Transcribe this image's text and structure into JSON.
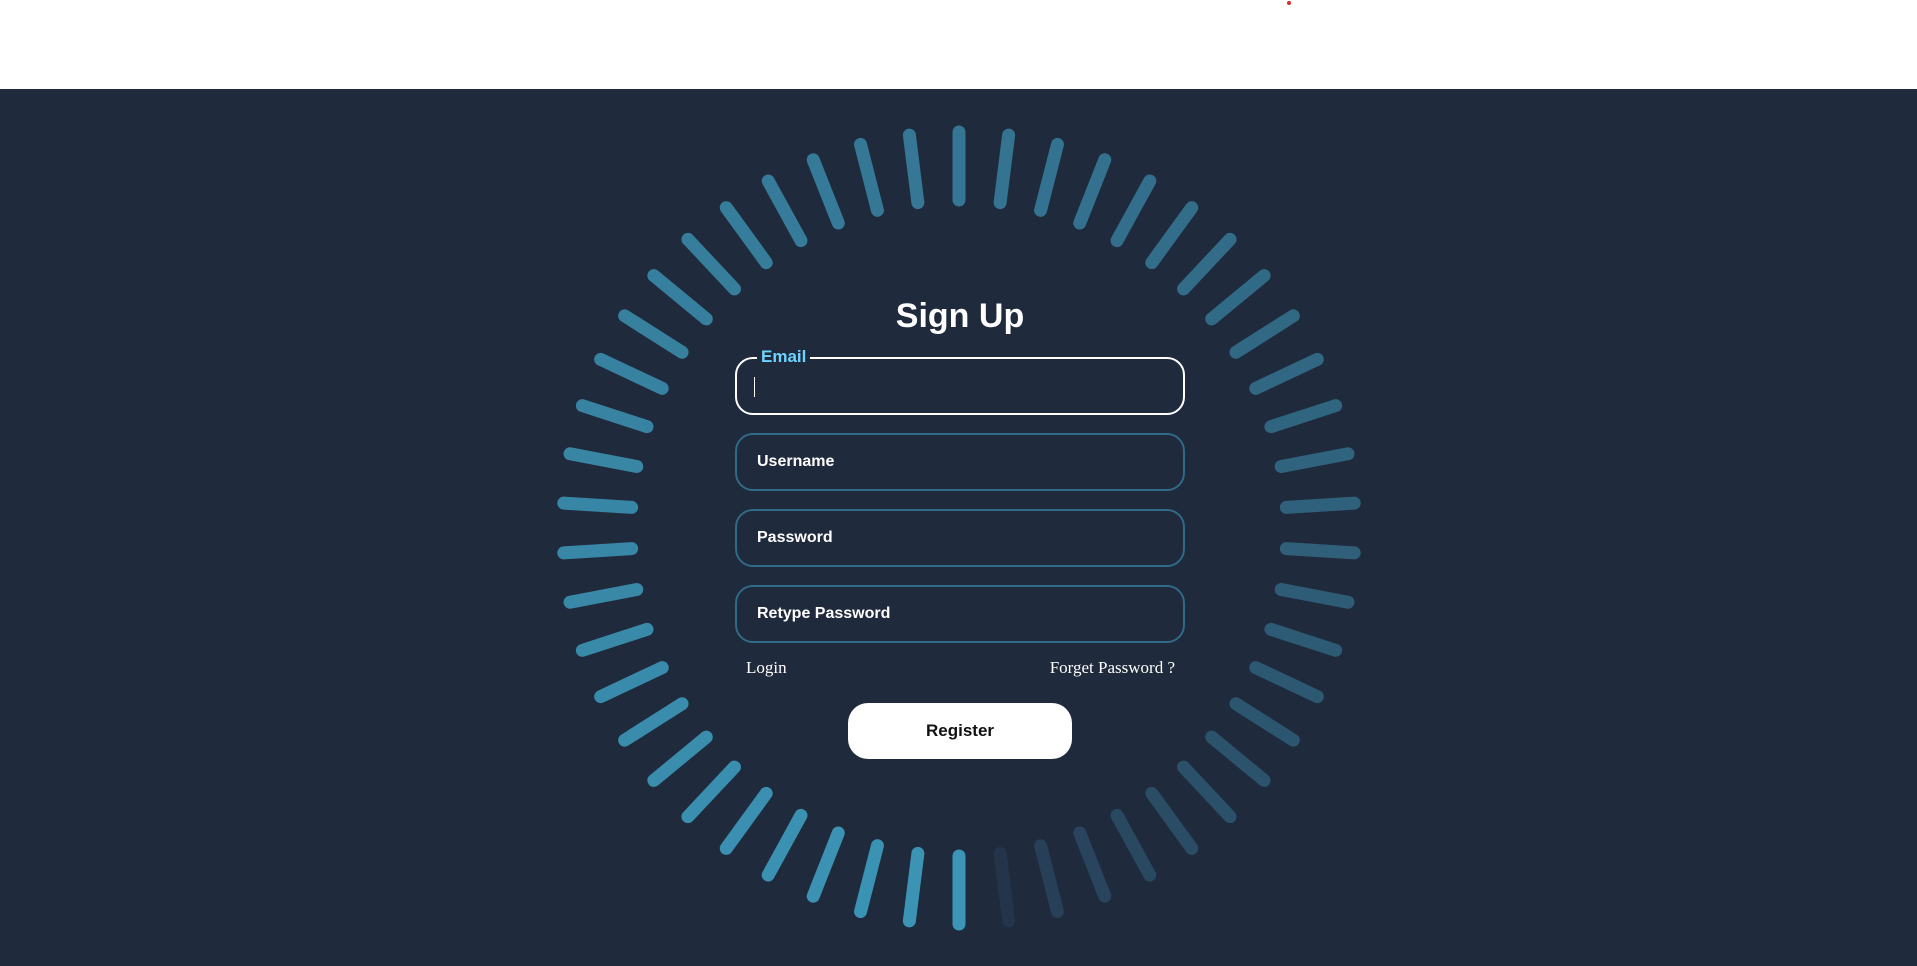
{
  "form": {
    "title": "Sign Up",
    "email": {
      "label": "Email",
      "value": ""
    },
    "username": {
      "placeholder": "Username"
    },
    "password": {
      "placeholder": "Password"
    },
    "retype_password": {
      "placeholder": "Retype Password"
    },
    "login_link": "Login",
    "forget_link": "Forget Password ?",
    "register_label": "Register"
  },
  "ring": {
    "bar_count": 50,
    "colors": {
      "bright": "#3c95b6",
      "dim": "#24344a",
      "background": "#1f2a3c"
    },
    "animation": "loading spinner"
  },
  "colors": {
    "accent": "#6ed3ff",
    "field_border": "#2f6a86",
    "page_bg": "#1f2a3c"
  }
}
